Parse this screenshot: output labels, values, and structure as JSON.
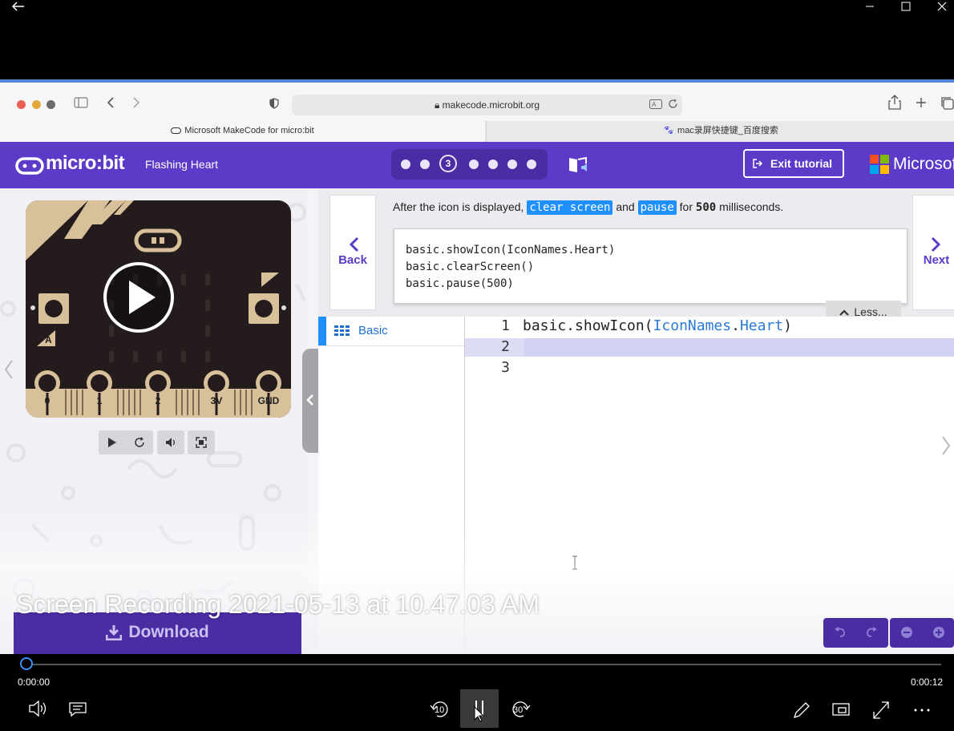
{
  "window": {
    "controls": [
      "back-icon",
      "minimize-icon",
      "maximize-icon",
      "close-icon"
    ]
  },
  "browser": {
    "url": "makecode.microbit.org",
    "tabs": [
      {
        "label": "Microsoft MakeCode for micro:bit"
      },
      {
        "label": "mac录屏快捷键_百度搜索"
      }
    ]
  },
  "makecode": {
    "logo": "micro:bit",
    "project_title": "Flashing Heart",
    "current_step": "3",
    "exit_label": "Exit tutorial",
    "brand": "Microsoft"
  },
  "simulator": {
    "pins": [
      "0",
      "1",
      "2",
      "3V",
      "GND"
    ],
    "button_a": "A",
    "button_b": "B"
  },
  "tutorial": {
    "back_label": "Back",
    "next_label": "Next",
    "instruction_pre": "After the icon is displayed,",
    "hl1": "clear screen",
    "instruction_and": "and",
    "hl2": "pause",
    "instruction_for": "for",
    "value": "500",
    "instruction_post": "milliseconds.",
    "code": [
      "basic.showIcon(IconNames.Heart)",
      "basic.clearScreen()",
      "basic.pause(500)"
    ],
    "less_label": "Less..."
  },
  "toolbox": {
    "category": "Basic"
  },
  "editor": {
    "line_numbers": [
      "1",
      "2",
      "3"
    ],
    "line1_a": "basic.showIcon(",
    "line1_b": "IconNames",
    "line1_c": ".",
    "line1_d": "Heart",
    "line1_e": ")"
  },
  "download_label": "Download",
  "player": {
    "title": "Screen Recording 2021-05-13 at 10.47.03 AM",
    "current_time": "0:00:00",
    "total_time": "0:00:12",
    "progress": 0,
    "skip_back": "10",
    "skip_forward": "30"
  }
}
